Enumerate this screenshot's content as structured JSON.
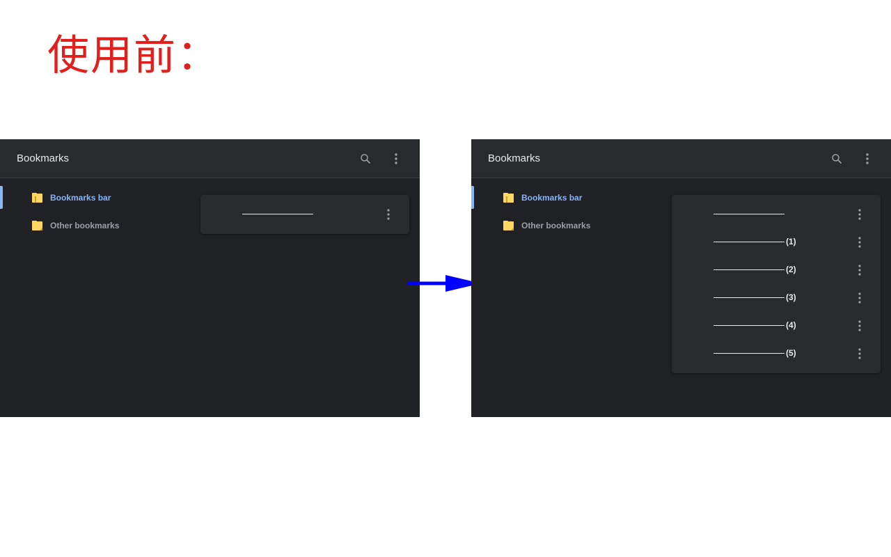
{
  "title": "使用前：",
  "colors": {
    "title": "#e0201c",
    "panel_bg": "#202124",
    "header_bg": "#292a2d",
    "accent": "#8ab4f8",
    "folder": "#fdd663",
    "arrow": "#0000ff"
  },
  "before": {
    "header": {
      "title": "Bookmarks",
      "search_icon": "search-icon",
      "more_icon": "more-vert-icon"
    },
    "sidebar": {
      "items": [
        {
          "label": "Bookmarks bar",
          "icon": "folder-open-icon",
          "selected": true
        },
        {
          "label": "Other bookmarks",
          "icon": "folder-icon",
          "selected": false
        }
      ]
    },
    "list": {
      "items": [
        {
          "suffix": ""
        }
      ]
    }
  },
  "after": {
    "header": {
      "title": "Bookmarks",
      "search_icon": "search-icon",
      "more_icon": "more-vert-icon"
    },
    "sidebar": {
      "items": [
        {
          "label": "Bookmarks bar",
          "icon": "folder-open-icon",
          "selected": true
        },
        {
          "label": "Other bookmarks",
          "icon": "folder-icon",
          "selected": false
        }
      ]
    },
    "list": {
      "items": [
        {
          "suffix": ""
        },
        {
          "suffix": "(1)"
        },
        {
          "suffix": "(2)"
        },
        {
          "suffix": "(3)"
        },
        {
          "suffix": "(4)"
        },
        {
          "suffix": "(5)"
        }
      ]
    }
  },
  "arrow_icon": "right-arrow-icon"
}
